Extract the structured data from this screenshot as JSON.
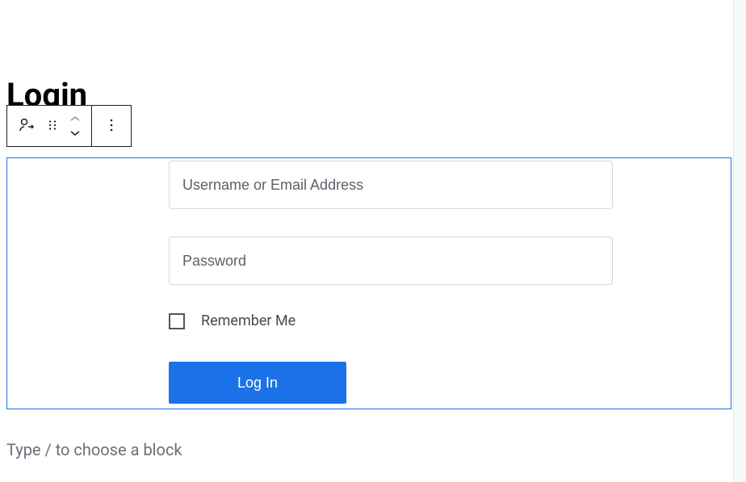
{
  "page": {
    "title": "Login"
  },
  "toolbar": {
    "block_icon": "login-out-icon",
    "drag_icon": "drag-handle-icon",
    "move_up_icon": "chevron-up-icon",
    "move_down_icon": "chevron-down-icon",
    "options_icon": "more-vertical-icon"
  },
  "form": {
    "username_placeholder": "Username or Email Address",
    "password_placeholder": "Password",
    "remember_label": "Remember Me",
    "submit_label": "Log In"
  },
  "editor": {
    "block_placeholder": "Type / to choose a block"
  }
}
